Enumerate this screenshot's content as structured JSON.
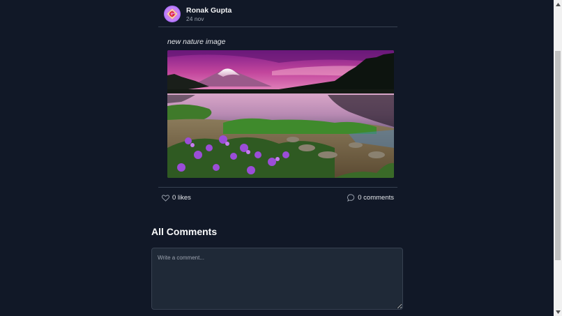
{
  "post": {
    "author": "Ronak Gupta",
    "date": "24 nov",
    "caption": "new nature image",
    "image_alt": "nature-landscape-image"
  },
  "actions": {
    "likes_label": "0 likes",
    "comments_label": "0 comments"
  },
  "comments_section": {
    "heading": "All Comments",
    "placeholder": "Write a comment..."
  },
  "colors": {
    "background": "#111827",
    "card_border": "#374151",
    "input_bg": "#1f2937",
    "muted_text": "#9ca3af"
  },
  "icons": {
    "like": "heart-icon",
    "comment": "chat-bubble-icon",
    "avatar": "avatar-logo-icon",
    "scroll_up": "scroll-up-arrow-icon",
    "scroll_down": "scroll-down-arrow-icon"
  }
}
